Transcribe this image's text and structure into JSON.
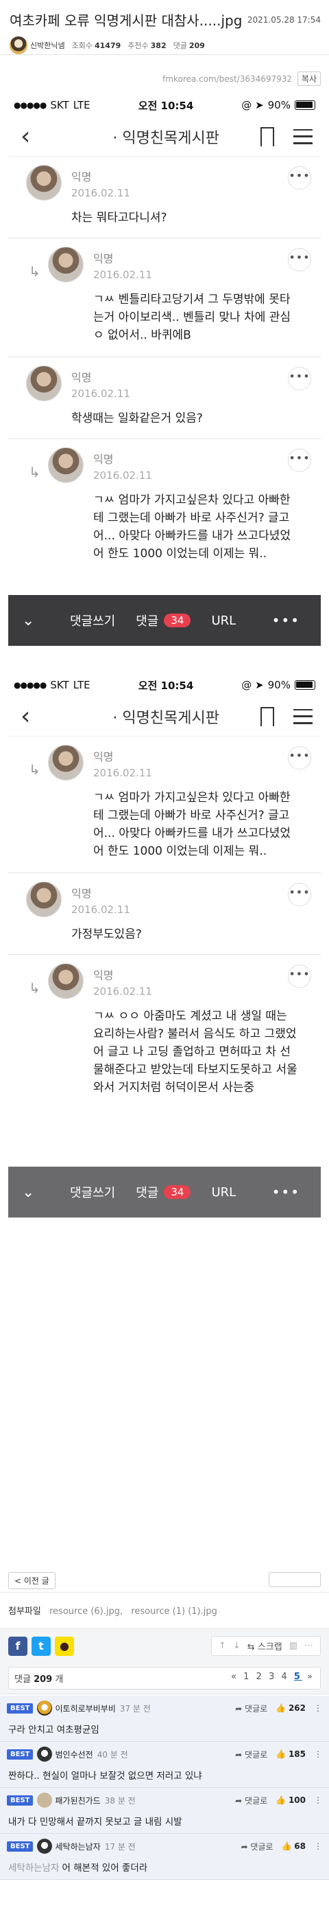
{
  "post": {
    "title": "여초카페 오류 익명게시판 대참사.....jpg",
    "date": "2021.05.28 17:54",
    "author": "신박한닉넴",
    "views_label": "조회수",
    "views": "41479",
    "recommend_label": "추천수",
    "recommend": "382",
    "comments_label": "댓글",
    "comments": "209",
    "source_url": "fmkorea.com/best/3634697932",
    "copy_label": "복사"
  },
  "phone": {
    "carrier": "SKT",
    "network": "LTE",
    "time": "오전 10:54",
    "battery": "90%",
    "nav_title": "· 익명친목게시판"
  },
  "screenshot1": {
    "comments": [
      {
        "type": "top",
        "name": "익명",
        "date": "2016.02.11",
        "text": "차는 뭐타고다니셔?"
      },
      {
        "type": "reply",
        "name": "익명",
        "date": "2016.02.11",
        "text": "ㄱㅆ 벤틀리타고당기셔 그 두명밖에 못타는거 아이보리색.. 벤틀리 맞나 차에 관심ㅇ 없어서.. 바퀴에B"
      },
      {
        "type": "top",
        "name": "익명",
        "date": "2016.02.11",
        "text": "학생때는 일화같은거 있음?"
      },
      {
        "type": "reply",
        "name": "익명",
        "date": "2016.02.11",
        "text": "ㄱㅆ 엄마가 가지고싶은차 있다고 아빠한테 그랬는데 아빠가 바로 사주신거? 글고 어... 아맞다 아빠카드를 내가 쓰고다녔었어 한도 1000 이었는데 이제는 뭐.."
      }
    ]
  },
  "screenshot2": {
    "comments": [
      {
        "type": "reply",
        "name": "익명",
        "date": "2016.02.11",
        "text": "ㄱㅆ 엄마가 가지고싶은차 있다고 아빠한테 그랬는데 아빠가 바로 사주신거? 글고 어... 아맞다 아빠카드를 내가 쓰고다녔었어 한도 1000 이었는데 이제는 뭐.."
      },
      {
        "type": "top",
        "name": "익명",
        "date": "2016.02.11",
        "text": "가정부도있음?"
      },
      {
        "type": "reply",
        "name": "익명",
        "date": "2016.02.11",
        "text": "ㄱㅆ ㅇㅇ 아줌마도 계셨고 내 생일 때는 요리하는사람? 불러서 음식도 하고 그랬었어 글고 나 고딩 졸업하고 면허따고 차 선물해준다고 받았는데 타보지도못하고 서울와서 거지처럼 허덕이몬서 사는중"
      }
    ]
  },
  "bottom_bar": {
    "write_label": "댓글쓰기",
    "comments_label": "댓글",
    "comments_count": "34",
    "url_label": "URL",
    "more_label": "•••"
  },
  "footer": {
    "prev_label": "< 이전 글",
    "attach_label": "첨부파일",
    "files": [
      "resource (6).jpg,",
      "resource (1) (1).jpg"
    ],
    "scrap_label": "스크랩",
    "comment_count_label": "댓글",
    "comment_count": "209",
    "comment_count_unit": "개",
    "pager": [
      "«",
      "1",
      "2",
      "3",
      "4",
      "5",
      "»"
    ],
    "pager_current": "5"
  },
  "best_comments": [
    {
      "tag": "BEST",
      "user": "이토히로부비부비",
      "ago": "37 분 전",
      "reply_label": "댓글로",
      "likes": "262",
      "text": "구라 안치고 여초평균임",
      "reply_to": ""
    },
    {
      "tag": "BEST",
      "user": "범인수선전",
      "ago": "40 분 전",
      "reply_label": "댓글로",
      "likes": "185",
      "text": "짠하다.. 현실이 얼마나 보잘것 없으면 저러고 있냐",
      "reply_to": ""
    },
    {
      "tag": "BEST",
      "user": "패가된친가드",
      "ago": "38 분 전",
      "reply_label": "댓글로",
      "likes": "100",
      "text": "내가 다 민망해서 끝까지 못보고 글 내림 시발",
      "reply_to": ""
    },
    {
      "tag": "BEST",
      "user": "세탁하는남자",
      "ago": "17 분 전",
      "reply_label": "댓글로",
      "likes": "68",
      "text": "어 해본적 있어 좋더라",
      "reply_to": "세탁하는남자"
    }
  ],
  "colors": {
    "best_tag": "#3a68d8",
    "badge": "#e8404e",
    "bottom_bar": "#3b3b3d"
  }
}
